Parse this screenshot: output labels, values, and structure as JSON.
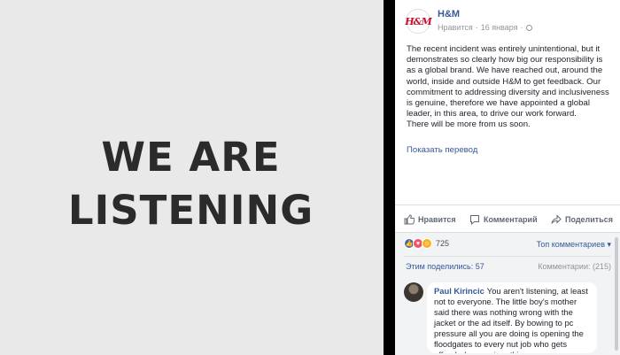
{
  "photo": {
    "headline": "WE ARE\nLISTENING"
  },
  "post": {
    "avatar_text": "H&M",
    "page_name": "H&M",
    "meta": {
      "like_label": "Нравится",
      "date": "16 января"
    },
    "text": "The recent incident was entirely unintentional, but it demonstrates so clearly how big our responsibility is as a global brand. We have reached out, around the world, inside and outside H&M to get feedback. Our commitment to addressing diversity and inclusiveness is genuine, therefore we have appointed a global leader, in this area, to drive our work forward.\nThere will be more from us soon.",
    "translate_link": "Показать перевод"
  },
  "actions": {
    "like": "Нравится",
    "comment": "Комментарий",
    "share": "Поделиться"
  },
  "stats": {
    "reaction_count": "725",
    "top_comments": "Топ комментариев ▾",
    "shares": "Этим поделились: 57",
    "comments": "Комментарии: (215)"
  },
  "comment": {
    "author": "Paul Kirincic",
    "text": "You aren't listening, at least not to everyone. The little boy's mother said there was nothing wrong with the jacket or the ad itself. By bowing to pc pressure all you are doing is opening the floodgates to every nut job who gets offended over minor things."
  },
  "colors": {
    "brand_red": "#c8102e",
    "link_blue": "#365899",
    "headline": "#2b2b2b",
    "photo_bg": "#e9e9e9"
  },
  "icons": [
    "globe-icon",
    "thumbs-up-icon",
    "comment-icon",
    "share-icon",
    "like-reaction-icon",
    "love-reaction-icon",
    "haha-reaction-icon"
  ]
}
